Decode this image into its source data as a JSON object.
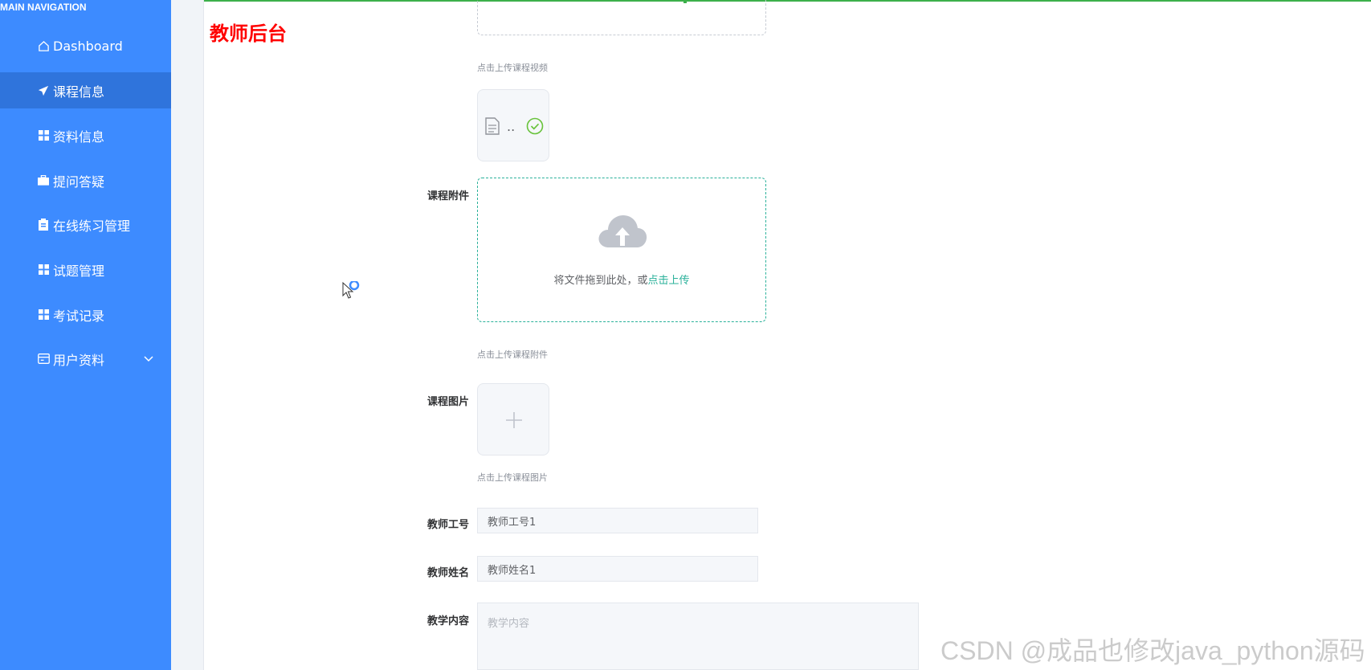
{
  "sidebar": {
    "header": "MAIN NAVIGATION",
    "items": [
      {
        "label": "Dashboard",
        "icon": "home-icon"
      },
      {
        "label": "课程信息",
        "icon": "send-icon",
        "active": true
      },
      {
        "label": "资料信息",
        "icon": "grid-icon"
      },
      {
        "label": "提问答疑",
        "icon": "briefcase-icon"
      },
      {
        "label": "在线练习管理",
        "icon": "clipboard-icon"
      },
      {
        "label": "试题管理",
        "icon": "grid-icon"
      },
      {
        "label": "考试记录",
        "icon": "grid-icon"
      },
      {
        "label": "用户资料",
        "icon": "id-card-icon",
        "has_submenu": true
      }
    ]
  },
  "brand": "教师后台",
  "form": {
    "video_hint": "点击上传课程视频",
    "video_file_name": "..",
    "attachment_label": "课程附件",
    "attachment_drop_text": "将文件拖到此处，或",
    "attachment_drop_link": "点击上传",
    "attachment_hint": "点击上传课程附件",
    "image_label": "课程图片",
    "image_hint": "点击上传课程图片",
    "teacher_id_label": "教师工号",
    "teacher_id_value": "教师工号1",
    "teacher_name_label": "教师姓名",
    "teacher_name_value": "教师姓名1",
    "content_label": "教学内容",
    "content_placeholder": "教学内容"
  },
  "watermark": "CSDN @成品也修改java_python源码",
  "colors": {
    "sidebar_bg": "#3d8bff",
    "sidebar_active": "#2f74dc",
    "brand_red": "#ff0000",
    "upload_accent": "#2ab19a",
    "success_green": "#67c23a"
  }
}
